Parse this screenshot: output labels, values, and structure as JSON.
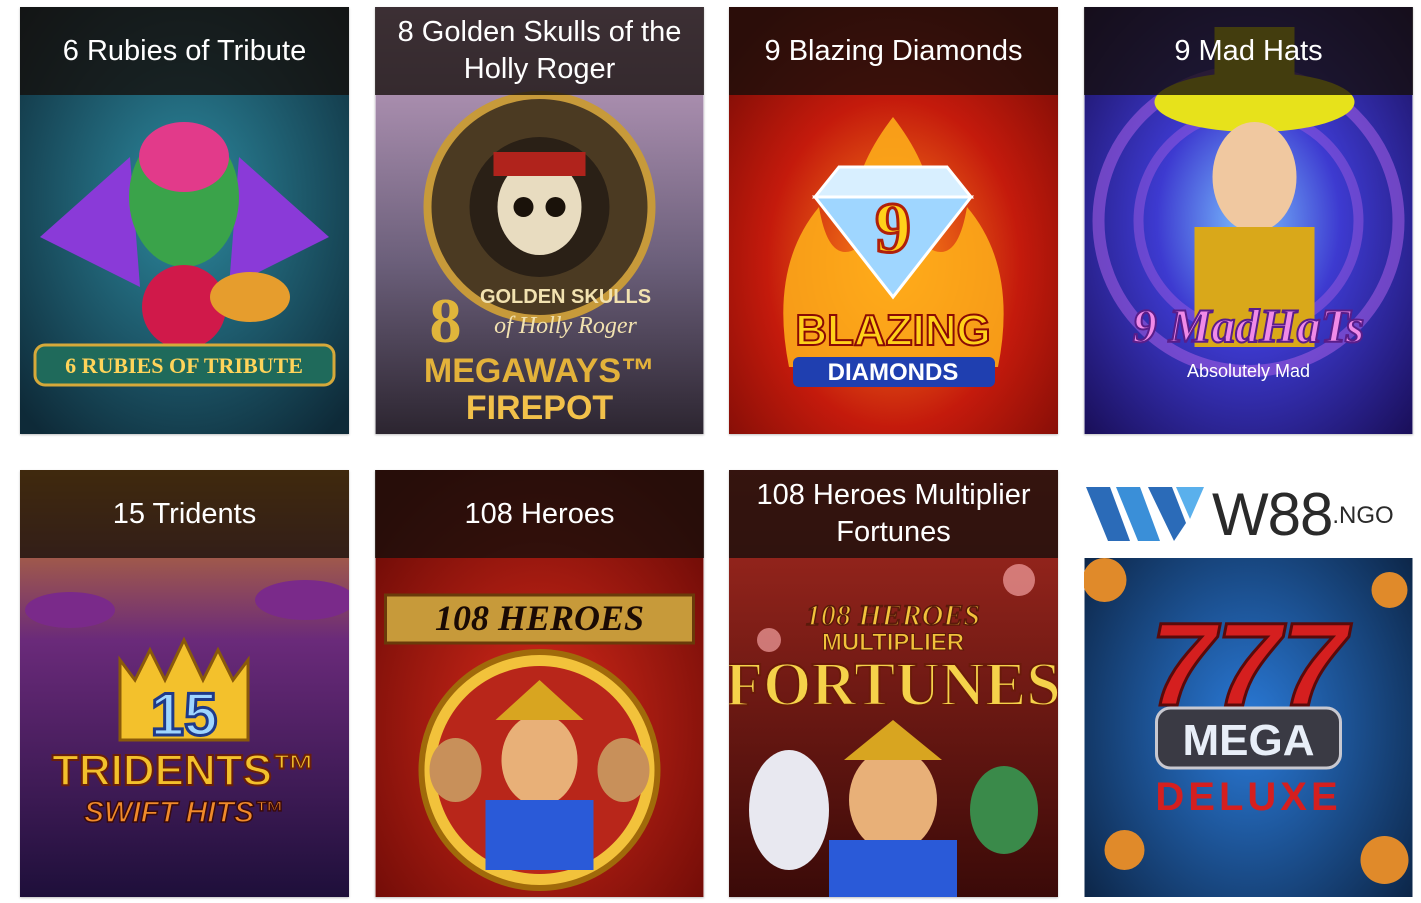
{
  "games": [
    {
      "title": "6 Rubies of Tribute",
      "art_title": "6 RUBIES OF TRIBUTE",
      "colors": {
        "bg": "#1c5a6e",
        "accent": "#8a3ad8"
      }
    },
    {
      "title": "8 Golden Skulls of the Holly Roger",
      "art_line1": "8",
      "art_line2": "GOLDEN SKULLS",
      "art_line3": "of Holly Roger",
      "art_line4": "MEGAWAYS™",
      "art_line5": "FIREPOT",
      "colors": {
        "bg": "#7b6f8a",
        "accent": "#d8a520"
      }
    },
    {
      "title": "9 Blazing Diamonds",
      "art_number": "9",
      "art_line1": "BLAZING",
      "art_line2": "DIAMONDS",
      "colors": {
        "bg": "#c41a0c",
        "accent": "#ffd11a"
      }
    },
    {
      "title": "9 Mad Hats",
      "art_line1": "9 MadHaTs",
      "art_line2": "Absolutely Mad",
      "colors": {
        "bg": "#2a2d9c",
        "accent": "#e7e21b"
      }
    },
    {
      "title": "15 Tridents",
      "art_number": "15",
      "art_line1": "TRIDENTS™",
      "art_line2": "SWIFT HITS™",
      "colors": {
        "bg": "#4a1f6b",
        "accent": "#f3c12c"
      }
    },
    {
      "title": "108 Heroes",
      "art_line1": "108 HEROES",
      "colors": {
        "bg": "#9c1510",
        "accent": "#f2c23b"
      }
    },
    {
      "title": "108 Heroes Multiplier Fortunes",
      "art_line1": "108 HEROES",
      "art_line2": "MULTIPLIER",
      "art_line3": "FORTUNES",
      "colors": {
        "bg": "#7c1a16",
        "accent": "#f2c23b"
      }
    }
  ],
  "promo": {
    "brand": "W88",
    "suffix": ".NGO",
    "art_number": "777",
    "art_line1": "MEGA",
    "art_line2": "DELUXE",
    "colors": {
      "bg": "#123c6b",
      "accent": "#d51f1f"
    }
  }
}
